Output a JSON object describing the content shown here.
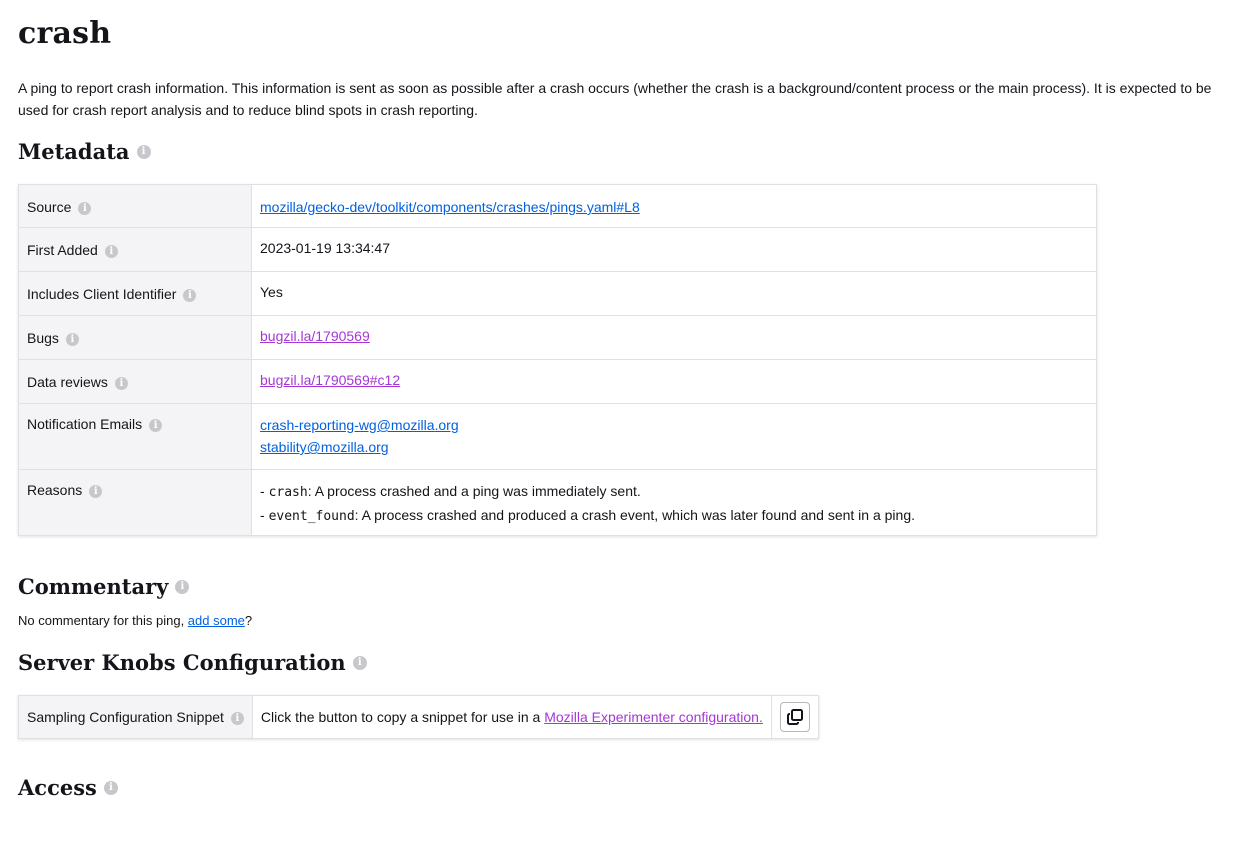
{
  "title": "crash",
  "description": "A ping to report crash information. This information is sent as soon as possible after a crash occurs (whether the crash is a background/content process or the main process). It is expected to be used for crash report analysis and to reduce blind spots in crash reporting.",
  "metadata": {
    "heading": "Metadata",
    "rows": {
      "source": {
        "label": "Source",
        "value": "mozilla/gecko-dev/toolkit/components/crashes/pings.yaml#L8"
      },
      "first_added": {
        "label": "First Added",
        "value": "2023-01-19 13:34:47"
      },
      "client_id": {
        "label": "Includes Client Identifier",
        "value": "Yes"
      },
      "bugs": {
        "label": "Bugs",
        "value": "bugzil.la/1790569"
      },
      "data_reviews": {
        "label": "Data reviews",
        "value": "bugzil.la/1790569#c12"
      },
      "emails": {
        "label": "Notification Emails",
        "values": [
          "crash-reporting-wg@mozilla.org",
          "stability@mozilla.org"
        ]
      },
      "reasons": {
        "label": "Reasons",
        "items": [
          {
            "prefix": "- ",
            "code": "crash",
            "text": ": A process crashed and a ping was immediately sent."
          },
          {
            "prefix": "- ",
            "code": "event_found",
            "text": ": A process crashed and produced a crash event, which was later found and sent in a ping."
          }
        ]
      }
    }
  },
  "commentary": {
    "heading": "Commentary",
    "text_before": "No commentary for this ping, ",
    "link": "add some",
    "text_after": "?"
  },
  "server_knobs": {
    "heading": "Server Knobs Configuration",
    "label": "Sampling Configuration Snippet",
    "text": "Click the button to copy a snippet for use in a ",
    "link": "Mozilla Experimenter configuration.",
    "button_icon": "copy-icon"
  },
  "access": {
    "heading": "Access"
  },
  "info_icon": "info-icon",
  "colors": {
    "link": "#0060df",
    "visited_link": "#a636d8",
    "label_bg": "#f4f4f6",
    "info_icon": "#c8c8cc"
  }
}
